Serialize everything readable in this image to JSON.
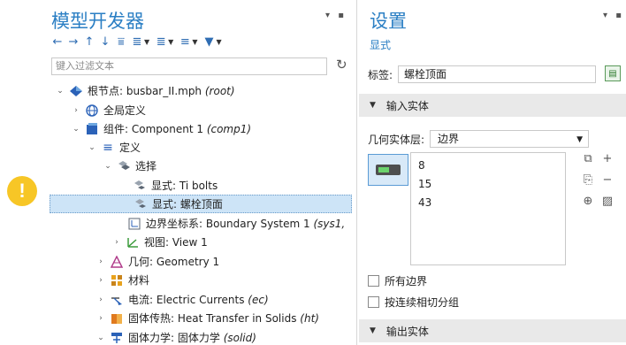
{
  "left": {
    "title": "模型开发器",
    "filter_placeholder": "键入过滤文本",
    "tree": [
      {
        "label": "根节点: busbar_II.mph",
        "suffix": "(root)",
        "arrow": "⌄",
        "icon": "root-icon"
      },
      {
        "label": "全局定义",
        "suffix": "",
        "arrow": "›",
        "icon": "globe-icon"
      },
      {
        "label": "组件: Component 1",
        "suffix": "(comp1)",
        "arrow": "⌄",
        "icon": "component-icon"
      },
      {
        "label": "定义",
        "suffix": "",
        "arrow": "⌄",
        "icon": "definitions-icon"
      },
      {
        "label": "选择",
        "suffix": "",
        "arrow": "⌄",
        "icon": "selection-icon"
      },
      {
        "label": "显式: Ti bolts",
        "suffix": "",
        "arrow": "",
        "icon": "explicit-icon"
      },
      {
        "label": "显式: 螺栓顶面",
        "suffix": "",
        "arrow": "",
        "icon": "explicit-icon"
      },
      {
        "label": "边界坐标系: Boundary System 1",
        "suffix": "(sys1,",
        "arrow": "",
        "icon": "coordinate-system-icon"
      },
      {
        "label": "视图: View 1",
        "suffix": "",
        "arrow": "›",
        "icon": "view-icon"
      },
      {
        "label": "几何: Geometry 1",
        "suffix": "",
        "arrow": "›",
        "icon": "geometry-icon"
      },
      {
        "label": "材料",
        "suffix": "",
        "arrow": "›",
        "icon": "materials-icon"
      },
      {
        "label": "电流: Electric Currents",
        "suffix": "(ec)",
        "arrow": "›",
        "icon": "electric-currents-icon"
      },
      {
        "label": "固体传热: Heat Transfer in Solids",
        "suffix": "(ht)",
        "arrow": "›",
        "icon": "heat-transfer-icon"
      },
      {
        "label": "固体力学: 固体力学",
        "suffix": "(solid)",
        "arrow": "⌄",
        "icon": "solid-mechanics-icon"
      }
    ]
  },
  "right": {
    "title": "设置",
    "subtitle": "显式",
    "label_caption": "标签:",
    "label_value": "螺栓顶面",
    "input_section": "输入实体",
    "level_caption": "几何实体层:",
    "level_value": "边界",
    "entities": [
      "8",
      "15",
      "43"
    ],
    "all_boundaries": "所有边界",
    "group_by_continuous": "按连续相切分组",
    "output_section": "输出实体"
  },
  "colors": {
    "accent": "#2b7fc4",
    "selected_row": "#cde4f7",
    "warning": "#f7c626"
  }
}
